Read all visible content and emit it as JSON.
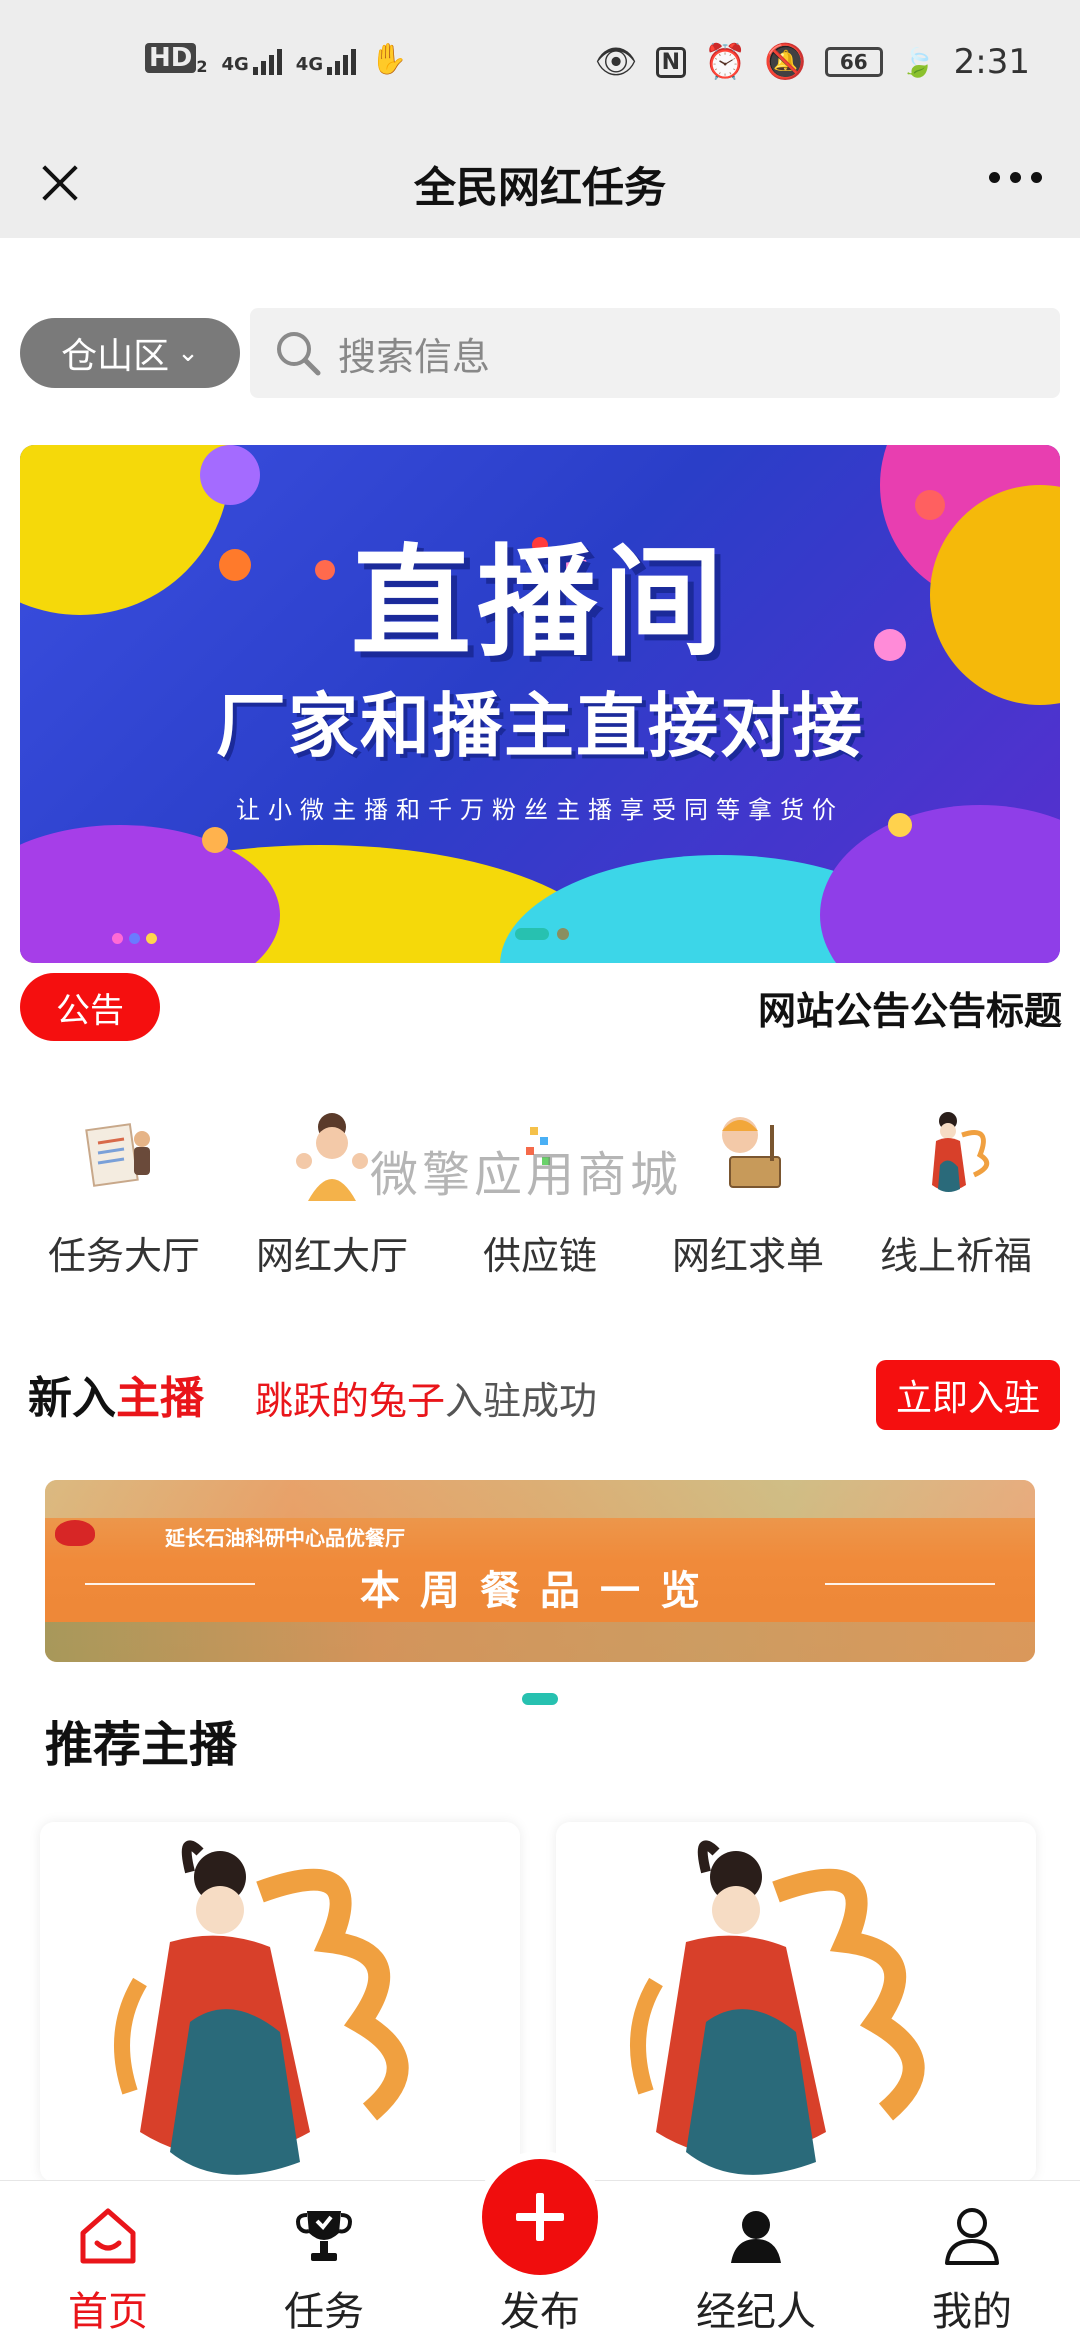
{
  "status_bar": {
    "left_hd": "HD",
    "left_hd_sub": "2",
    "left_net1": "4G",
    "left_net2": "4G",
    "battery": "66",
    "time": "2:31"
  },
  "nav": {
    "title": "全民网红任务"
  },
  "search": {
    "district": "仓山区",
    "placeholder": "搜索信息"
  },
  "banner": {
    "title": "直播间",
    "subtitle": "厂家和播主直接对接",
    "caption": "让小微主播和千万粉丝主播享受同等拿货价"
  },
  "notice": {
    "badge": "公告",
    "text": "网站公告公告标题"
  },
  "categories": [
    {
      "label": "任务大厅",
      "icon": "document-person-icon"
    },
    {
      "label": "网红大厅",
      "icon": "girl-waving-icon"
    },
    {
      "label": "供应链",
      "icon": "supply-chain-icon"
    },
    {
      "label": "网红求单",
      "icon": "boy-sign-icon"
    },
    {
      "label": "线上祈福",
      "icon": "fairy-icon"
    }
  ],
  "watermark": "微擎应用商城",
  "new_streamer": {
    "prefix": "新入",
    "highlight": "主播",
    "user": "跳跃的兔子",
    "msg": "入驻成功",
    "button": "立即入驻"
  },
  "menu_banner": {
    "org": "延长石油科研中心品优餐厅",
    "title": "本周餐品一览"
  },
  "recommended": {
    "title": "推荐主播"
  },
  "tab_bar": {
    "tabs": [
      {
        "label": "首页",
        "icon": "home-icon"
      },
      {
        "label": "任务",
        "icon": "trophy-icon"
      },
      {
        "label": "发布",
        "icon": "plus-icon"
      },
      {
        "label": "经纪人",
        "icon": "person-filled-icon"
      },
      {
        "label": "我的",
        "icon": "person-outline-icon"
      }
    ]
  },
  "colors": {
    "accent": "#f50f0f",
    "teal_indicator": "#27c1b0",
    "district_bg": "#7a7a7a"
  }
}
